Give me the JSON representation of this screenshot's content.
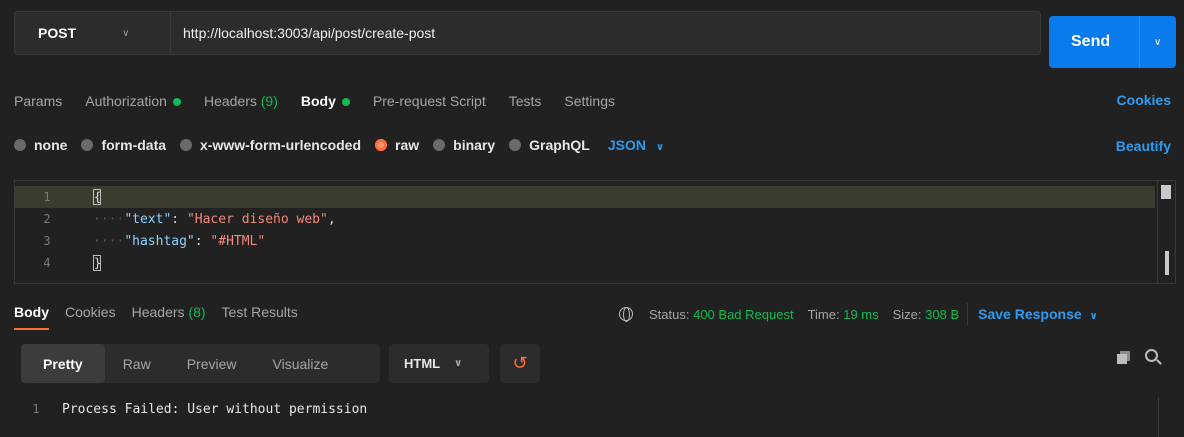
{
  "request": {
    "method": "POST",
    "url": "http://localhost:3003/api/post/create-post",
    "send_label": "Send"
  },
  "request_tabs": [
    {
      "label": "Params"
    },
    {
      "label": "Authorization",
      "indicator": "dot"
    },
    {
      "label": "Headers",
      "count": "(9)"
    },
    {
      "label": "Body",
      "indicator": "dot",
      "active": true
    },
    {
      "label": "Pre-request Script"
    },
    {
      "label": "Tests"
    },
    {
      "label": "Settings"
    }
  ],
  "cookies_link": "Cookies",
  "body_types": {
    "options": [
      "none",
      "form-data",
      "x-www-form-urlencoded",
      "raw",
      "binary",
      "GraphQL"
    ],
    "selected": "raw",
    "format": "JSON",
    "beautify_label": "Beautify"
  },
  "editor": {
    "lines": [
      {
        "n": "1",
        "open": "{"
      },
      {
        "n": "2",
        "key": "\"text\"",
        "value": "\"Hacer diseño web\"",
        "trail": ","
      },
      {
        "n": "3",
        "key": "\"hashtag\"",
        "value": "\"#HTML\"",
        "trail": ""
      },
      {
        "n": "4",
        "close": "}"
      }
    ]
  },
  "response": {
    "tabs": [
      {
        "label": "Body",
        "active": true
      },
      {
        "label": "Cookies"
      },
      {
        "label": "Headers",
        "count": "(8)"
      },
      {
        "label": "Test Results"
      }
    ],
    "status_label": "Status:",
    "status_value": "400 Bad Request",
    "time_label": "Time:",
    "time_value": "19 ms",
    "size_label": "Size:",
    "size_value": "308 B",
    "save_label": "Save Response",
    "view_tabs": [
      "Pretty",
      "Raw",
      "Preview",
      "Visualize"
    ],
    "view_active": "Pretty",
    "format": "HTML",
    "body_line_number": "1",
    "body_text": "Process Failed: User without permission"
  },
  "colors": {
    "accent_orange": "#ff6c37",
    "link_blue": "#2d9bf0",
    "send_blue": "#097bed",
    "status_green": "#0cbb52"
  }
}
